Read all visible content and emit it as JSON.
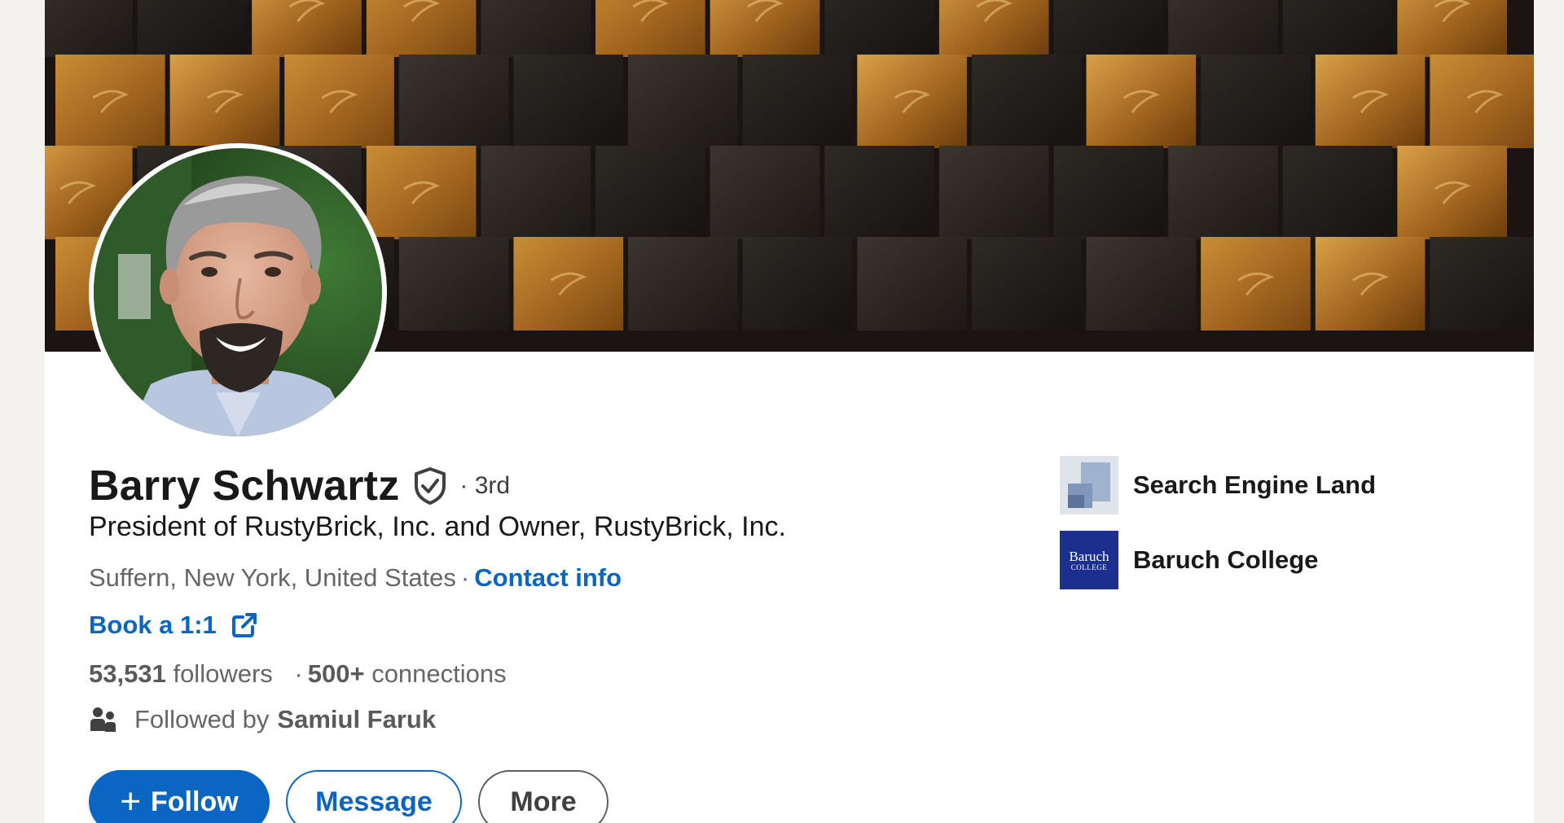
{
  "profile": {
    "name": "Barry Schwartz",
    "degree": "· 3rd",
    "headline": "President of RustyBrick, Inc. and Owner, RustyBrick, Inc.",
    "location": "Suffern, New York, United States",
    "location_separator": "·",
    "contact_info_label": "Contact info",
    "booking_label": "Book a 1:1",
    "followers_count": "53,531",
    "followers_label": "followers",
    "connections_count": "500+",
    "connections_label": "connections",
    "stats_separator": "·",
    "followed_by_prefix": "Followed by",
    "followed_by_name": "Samiul Faruk"
  },
  "actions": {
    "follow_label": "Follow",
    "follow_plus": "+",
    "message_label": "Message",
    "more_label": "More"
  },
  "organizations": [
    {
      "name": "Search Engine Land",
      "logo": "search-engine-land-logo"
    },
    {
      "name": "Baruch College",
      "logo": "baruch-college-logo",
      "logo_text_line1": "Baruch",
      "logo_text_line2": "COLLEGE"
    }
  ],
  "icons": {
    "verified": "shield-check-icon",
    "external_link": "external-link-icon",
    "people": "people-icon"
  },
  "colors": {
    "accent": "#0a66c2",
    "page_background": "#f4f2ee",
    "card_background": "#ffffff",
    "text_primary": "#191919",
    "text_secondary": "#666666",
    "baruch_blue": "#1b2f8f"
  }
}
